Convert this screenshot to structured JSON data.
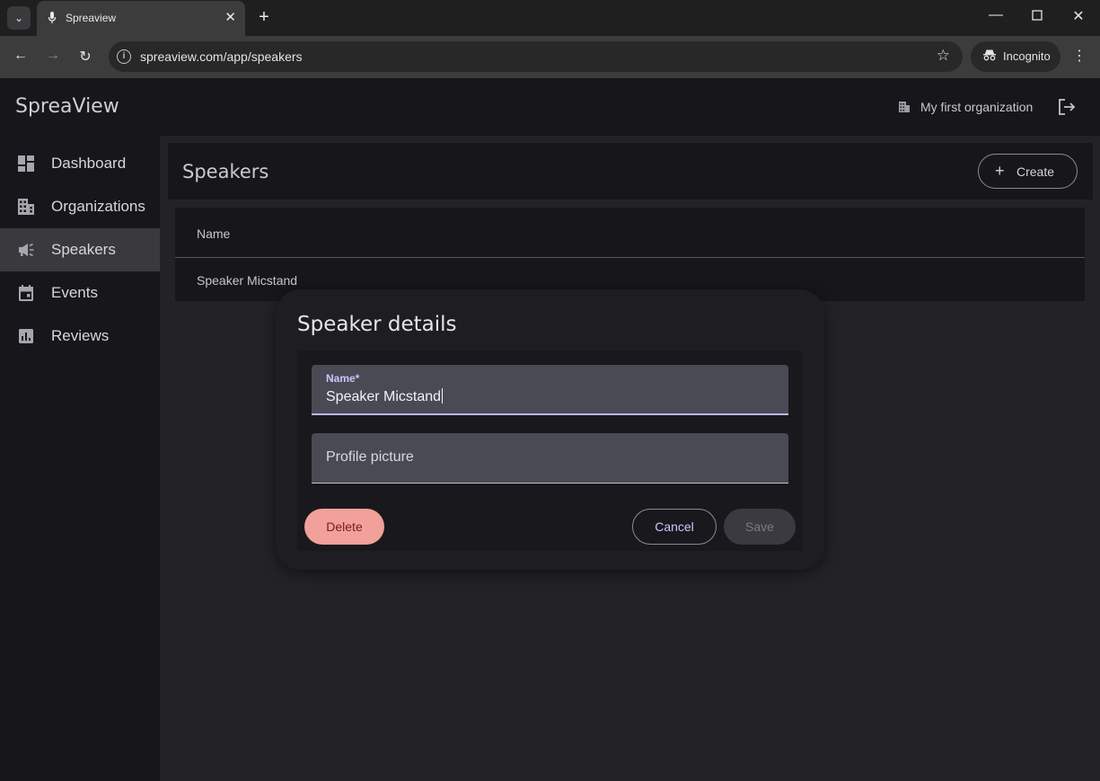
{
  "browser": {
    "tab_title": "Spreaview",
    "url": "spreaview.com/app/speakers",
    "incognito_label": "Incognito",
    "icons": [
      "tab-search-icon",
      "favicon-microphone-icon",
      "close-tab-icon",
      "new-tab-icon",
      "minimize-icon",
      "maximize-icon",
      "close-window-icon",
      "back-icon",
      "forward-icon",
      "reload-icon",
      "site-info-icon",
      "bookmark-star-icon",
      "incognito-icon",
      "menu-icon"
    ]
  },
  "app": {
    "brand": "SpreaView",
    "organization": "My first organization",
    "sidebar": {
      "items": [
        {
          "label": "Dashboard",
          "icon": "dashboard-icon",
          "active": false
        },
        {
          "label": "Organizations",
          "icon": "organizations-icon",
          "active": false
        },
        {
          "label": "Speakers",
          "icon": "campaign-icon",
          "active": true
        },
        {
          "label": "Events",
          "icon": "calendar-icon",
          "active": false
        },
        {
          "label": "Reviews",
          "icon": "chart-icon",
          "active": false
        }
      ]
    },
    "page": {
      "title": "Speakers",
      "create_label": "Create",
      "table": {
        "columns": [
          "Name"
        ],
        "rows": [
          [
            "Speaker Micstand"
          ]
        ]
      }
    },
    "dialog": {
      "title": "Speaker details",
      "name_label": "Name*",
      "name_value": "Speaker Micstand",
      "picture_label": "Profile picture",
      "delete_label": "Delete",
      "cancel_label": "Cancel",
      "save_label": "Save"
    },
    "colors": {
      "accent": "#c8c6ff",
      "delete": "#f2a09a",
      "surface": "#17171b",
      "background": "#232325"
    }
  }
}
